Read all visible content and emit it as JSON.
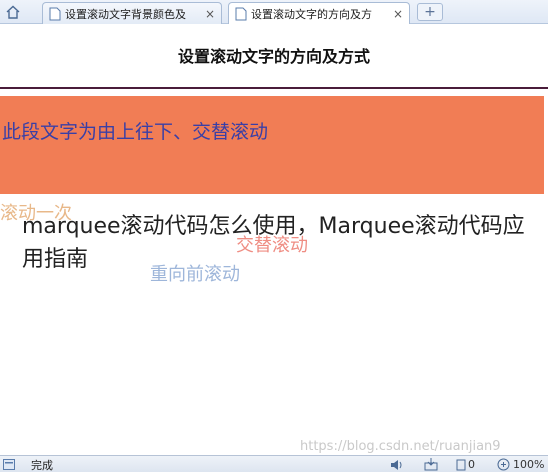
{
  "tabs": [
    {
      "label": "设置滚动文字背景颜色及",
      "close": "×"
    },
    {
      "label": "设置滚动文字的方向及方",
      "close": "×"
    }
  ],
  "new_tab": "+",
  "page": {
    "title": "设置滚动文字的方向及方式",
    "scroll_1": "此段文字为由上往下、交替滚动",
    "scroll_2": "滚动一次",
    "scroll_3": "交替滚动",
    "scroll_4": "重向前滚动",
    "overlay_title": "marquee滚动代码怎么使用，Marquee滚动代码应用指南"
  },
  "status": {
    "text": "完成",
    "watermark": "https://blog.csdn.net/ruanjian9",
    "counter": "0",
    "zoom": "100%"
  },
  "colors": {
    "scroll_box_bg": "#f17d55",
    "title_rule": "#4a1c3a"
  }
}
